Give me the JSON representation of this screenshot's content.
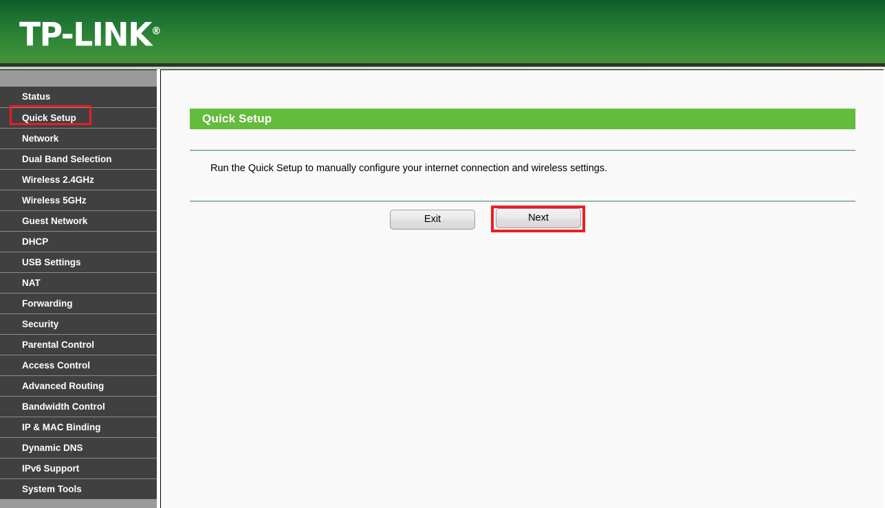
{
  "header": {
    "brand": "TP-LINK",
    "registered_mark": "®",
    "brand_color": "#2d8435"
  },
  "sidebar": {
    "items": [
      {
        "label": "Status",
        "highlighted": false
      },
      {
        "label": "Quick Setup",
        "highlighted": true
      },
      {
        "label": "Network",
        "highlighted": false
      },
      {
        "label": "Dual Band Selection",
        "highlighted": false
      },
      {
        "label": "Wireless 2.4GHz",
        "highlighted": false
      },
      {
        "label": "Wireless 5GHz",
        "highlighted": false
      },
      {
        "label": "Guest Network",
        "highlighted": false
      },
      {
        "label": "DHCP",
        "highlighted": false
      },
      {
        "label": "USB Settings",
        "highlighted": false
      },
      {
        "label": "NAT",
        "highlighted": false
      },
      {
        "label": "Forwarding",
        "highlighted": false
      },
      {
        "label": "Security",
        "highlighted": false
      },
      {
        "label": "Parental Control",
        "highlighted": false
      },
      {
        "label": "Access Control",
        "highlighted": false
      },
      {
        "label": "Advanced Routing",
        "highlighted": false
      },
      {
        "label": "Bandwidth Control",
        "highlighted": false
      },
      {
        "label": "IP & MAC Binding",
        "highlighted": false
      },
      {
        "label": "Dynamic DNS",
        "highlighted": false
      },
      {
        "label": "IPv6 Support",
        "highlighted": false
      },
      {
        "label": "System Tools",
        "highlighted": false
      }
    ]
  },
  "main": {
    "panel_title": "Quick Setup",
    "panel_title_bg": "#63bc3c",
    "description": "Run the Quick Setup to manually configure your internet connection and wireless settings.",
    "buttons": {
      "exit": "Exit",
      "next": "Next"
    },
    "highlight_color": "#ee1c23"
  }
}
